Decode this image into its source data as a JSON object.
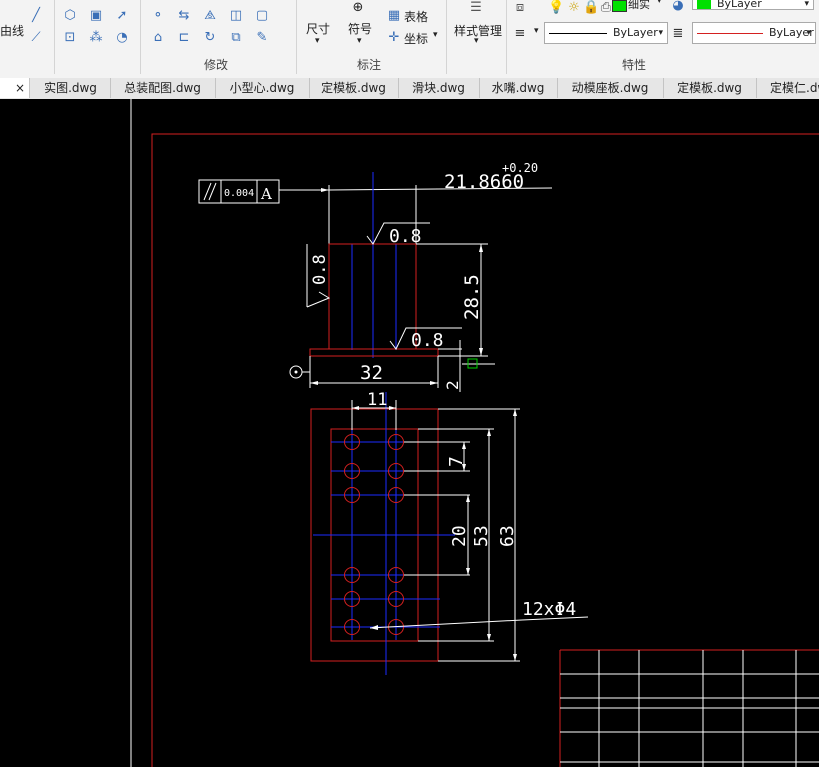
{
  "ribbon": {
    "left_partial_label": "由线",
    "panels": {
      "modify": {
        "label": "修改"
      },
      "annotation": {
        "label": "标注",
        "dimension": "尺寸",
        "symbol": "符号",
        "table": "表格",
        "coordinate": "坐标"
      },
      "style": {
        "label": "样式管理"
      },
      "properties": {
        "label": "特性",
        "color_value": "ByLayer",
        "linetype_value": "ByLayer",
        "lineweight_value": "ByLayer",
        "layer_name_partial": "细实"
      }
    }
  },
  "tabs": [
    {
      "label": "实图.dwg"
    },
    {
      "label": "总装配图.dwg"
    },
    {
      "label": "小型心.dwg"
    },
    {
      "label": "定模板.dwg"
    },
    {
      "label": "滑块.dwg"
    },
    {
      "label": "水嘴.dwg"
    },
    {
      "label": "动模座板.dwg"
    },
    {
      "label": "定模板.dwg"
    },
    {
      "label": "定模仁.dwg"
    }
  ],
  "tab_close": "×",
  "drawing": {
    "tolerance_value": "0.004",
    "tolerance_datum": "A",
    "dim_top": "21.8660",
    "dim_top_tolerance": "+0.20",
    "roughness_top": "0.8",
    "roughness_side": "0.8",
    "roughness_bottom": "0.8",
    "dim_height": "28.5",
    "dim_width": "32",
    "dim_base": "2",
    "dim_hole_spacing": "11",
    "dim_7": "7",
    "dim_20": "20",
    "dim_53": "53",
    "dim_63": "63",
    "hole_note": "12xΦ4"
  },
  "colors": {
    "outline": "#d42020",
    "centerline": "#1c2cff",
    "dimension": "#ffffff",
    "layer_swatch": "#00e000",
    "ribbon_bg": "#f3f3f3"
  }
}
